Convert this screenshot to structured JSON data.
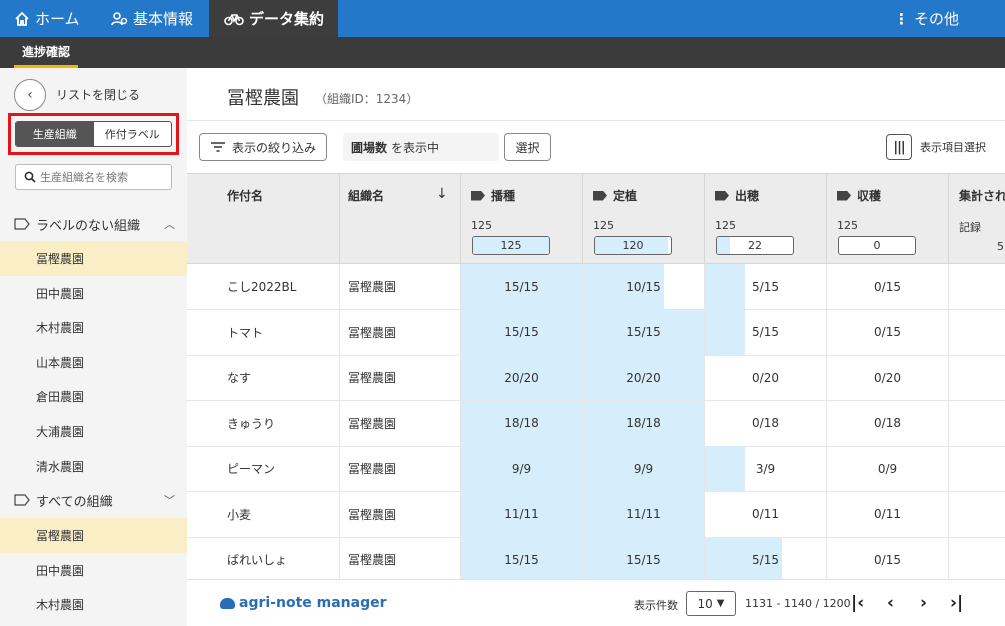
{
  "nav": {
    "home": "ホーム",
    "basic": "基本情報",
    "data": "データ集約",
    "other": "その他"
  },
  "subnav": {
    "progress": "進捗確認"
  },
  "sidebar": {
    "close_label": "リストを閉じる",
    "toggle": [
      "生産組織",
      "作付ラベル"
    ],
    "search_placeholder": "生産組織名を検索",
    "group1": {
      "label": "ラベルのない組織",
      "items": [
        "冨樫農園",
        "田中農園",
        "木村農園",
        "山本農園",
        "倉田農園",
        "大浦農園",
        "清水農園"
      ]
    },
    "group2": {
      "label": "すべての組織",
      "items": [
        "冨樫農園",
        "田中農園",
        "木村農園"
      ]
    }
  },
  "main": {
    "title": "冨樫農園",
    "org_id": "（組織ID：1234）",
    "filter_label": "表示の絞り込み",
    "show_strong": "圃場数",
    "show_rest": "を表示中",
    "select_label": "選択",
    "column_select_label": "表示項目選択"
  },
  "table": {
    "headers": {
      "crop": "作付名",
      "org": "組織名",
      "sort": "↓",
      "stages": [
        {
          "name": "播種",
          "total": "125",
          "value": "125",
          "ratio": 1.0
        },
        {
          "name": "定植",
          "total": "125",
          "value": "120",
          "ratio": 0.96
        },
        {
          "name": "出穂",
          "total": "125",
          "value": "22",
          "ratio": 0.176
        },
        {
          "name": "収穫",
          "total": "125",
          "value": "0",
          "ratio": 0.0
        }
      ],
      "agg": "集計され",
      "agg_sub": "記録",
      "agg_val": "5"
    },
    "rows": [
      {
        "crop": "こし2022BL",
        "org": "冨樫農園",
        "cells": [
          {
            "text": "15/15",
            "ratio": 1
          },
          {
            "text": "10/15",
            "ratio": 0.667
          },
          {
            "text": "5/15",
            "ratio": 0.333
          },
          {
            "text": "0/15",
            "ratio": 0
          }
        ]
      },
      {
        "crop": "トマト",
        "org": "冨樫農園",
        "cells": [
          {
            "text": "15/15",
            "ratio": 1
          },
          {
            "text": "15/15",
            "ratio": 1
          },
          {
            "text": "5/15",
            "ratio": 0.333
          },
          {
            "text": "0/15",
            "ratio": 0
          }
        ]
      },
      {
        "crop": "なす",
        "org": "冨樫農園",
        "cells": [
          {
            "text": "20/20",
            "ratio": 1
          },
          {
            "text": "20/20",
            "ratio": 1
          },
          {
            "text": "0/20",
            "ratio": 0
          },
          {
            "text": "0/20",
            "ratio": 0
          }
        ]
      },
      {
        "crop": "きゅうり",
        "org": "冨樫農園",
        "cells": [
          {
            "text": "18/18",
            "ratio": 1
          },
          {
            "text": "18/18",
            "ratio": 1
          },
          {
            "text": "0/18",
            "ratio": 0
          },
          {
            "text": "0/18",
            "ratio": 0
          }
        ]
      },
      {
        "crop": "ピーマン",
        "org": "冨樫農園",
        "cells": [
          {
            "text": "9/9",
            "ratio": 1
          },
          {
            "text": "9/9",
            "ratio": 1
          },
          {
            "text": "3/9",
            "ratio": 0.333
          },
          {
            "text": "0/9",
            "ratio": 0
          }
        ]
      },
      {
        "crop": "小麦",
        "org": "冨樫農園",
        "cells": [
          {
            "text": "11/11",
            "ratio": 1
          },
          {
            "text": "11/11",
            "ratio": 1
          },
          {
            "text": "0/11",
            "ratio": 0
          },
          {
            "text": "0/11",
            "ratio": 0
          }
        ]
      },
      {
        "crop": "ばれいしょ",
        "org": "冨樫農園",
        "cells": [
          {
            "text": "15/15",
            "ratio": 1
          },
          {
            "text": "15/15",
            "ratio": 1
          },
          {
            "text": "5/15",
            "ratio": 0.633
          },
          {
            "text": "0/15",
            "ratio": 0
          }
        ]
      }
    ]
  },
  "footer": {
    "logo": "agri-note manager",
    "count_label": "表示件数",
    "page_size": "10",
    "range": "1131 - 1140 / 1200"
  }
}
